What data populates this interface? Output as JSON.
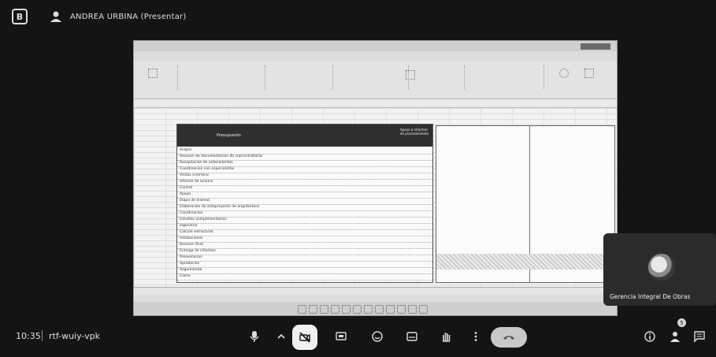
{
  "window": {
    "icon_letter": "B"
  },
  "presenter": {
    "label": "ANDREA URBINA (Presentar)"
  },
  "shared_screen": {
    "table_header": "Presupuesto",
    "table_note": "Apoyo a informes de procesamiento",
    "rows": [
      "Acopio",
      "Revision de documentacion de subcontratistas",
      "Recopilacion de antecedentes",
      "Coordinacion con especialistas",
      "Visitas a terreno",
      "Informe de avance",
      "Control",
      "Apoyo",
      "Etapa de disenos",
      "Elaboracion de anteproyecto de arquitectura",
      "Coordinacion",
      "Estudios complementarios",
      "Ingenieria",
      "Calculo estructural",
      "Instalaciones",
      "Revision final",
      "Entrega de informes",
      "Presentacion",
      "Aprobacion",
      "Seguimiento",
      "Cierre"
    ]
  },
  "participant_tile": {
    "name": "Gerencia Integral De Obras"
  },
  "bottom_bar": {
    "time": "10:35",
    "meeting_code": "rtf-wuiy-vpk",
    "people_count": "5"
  }
}
